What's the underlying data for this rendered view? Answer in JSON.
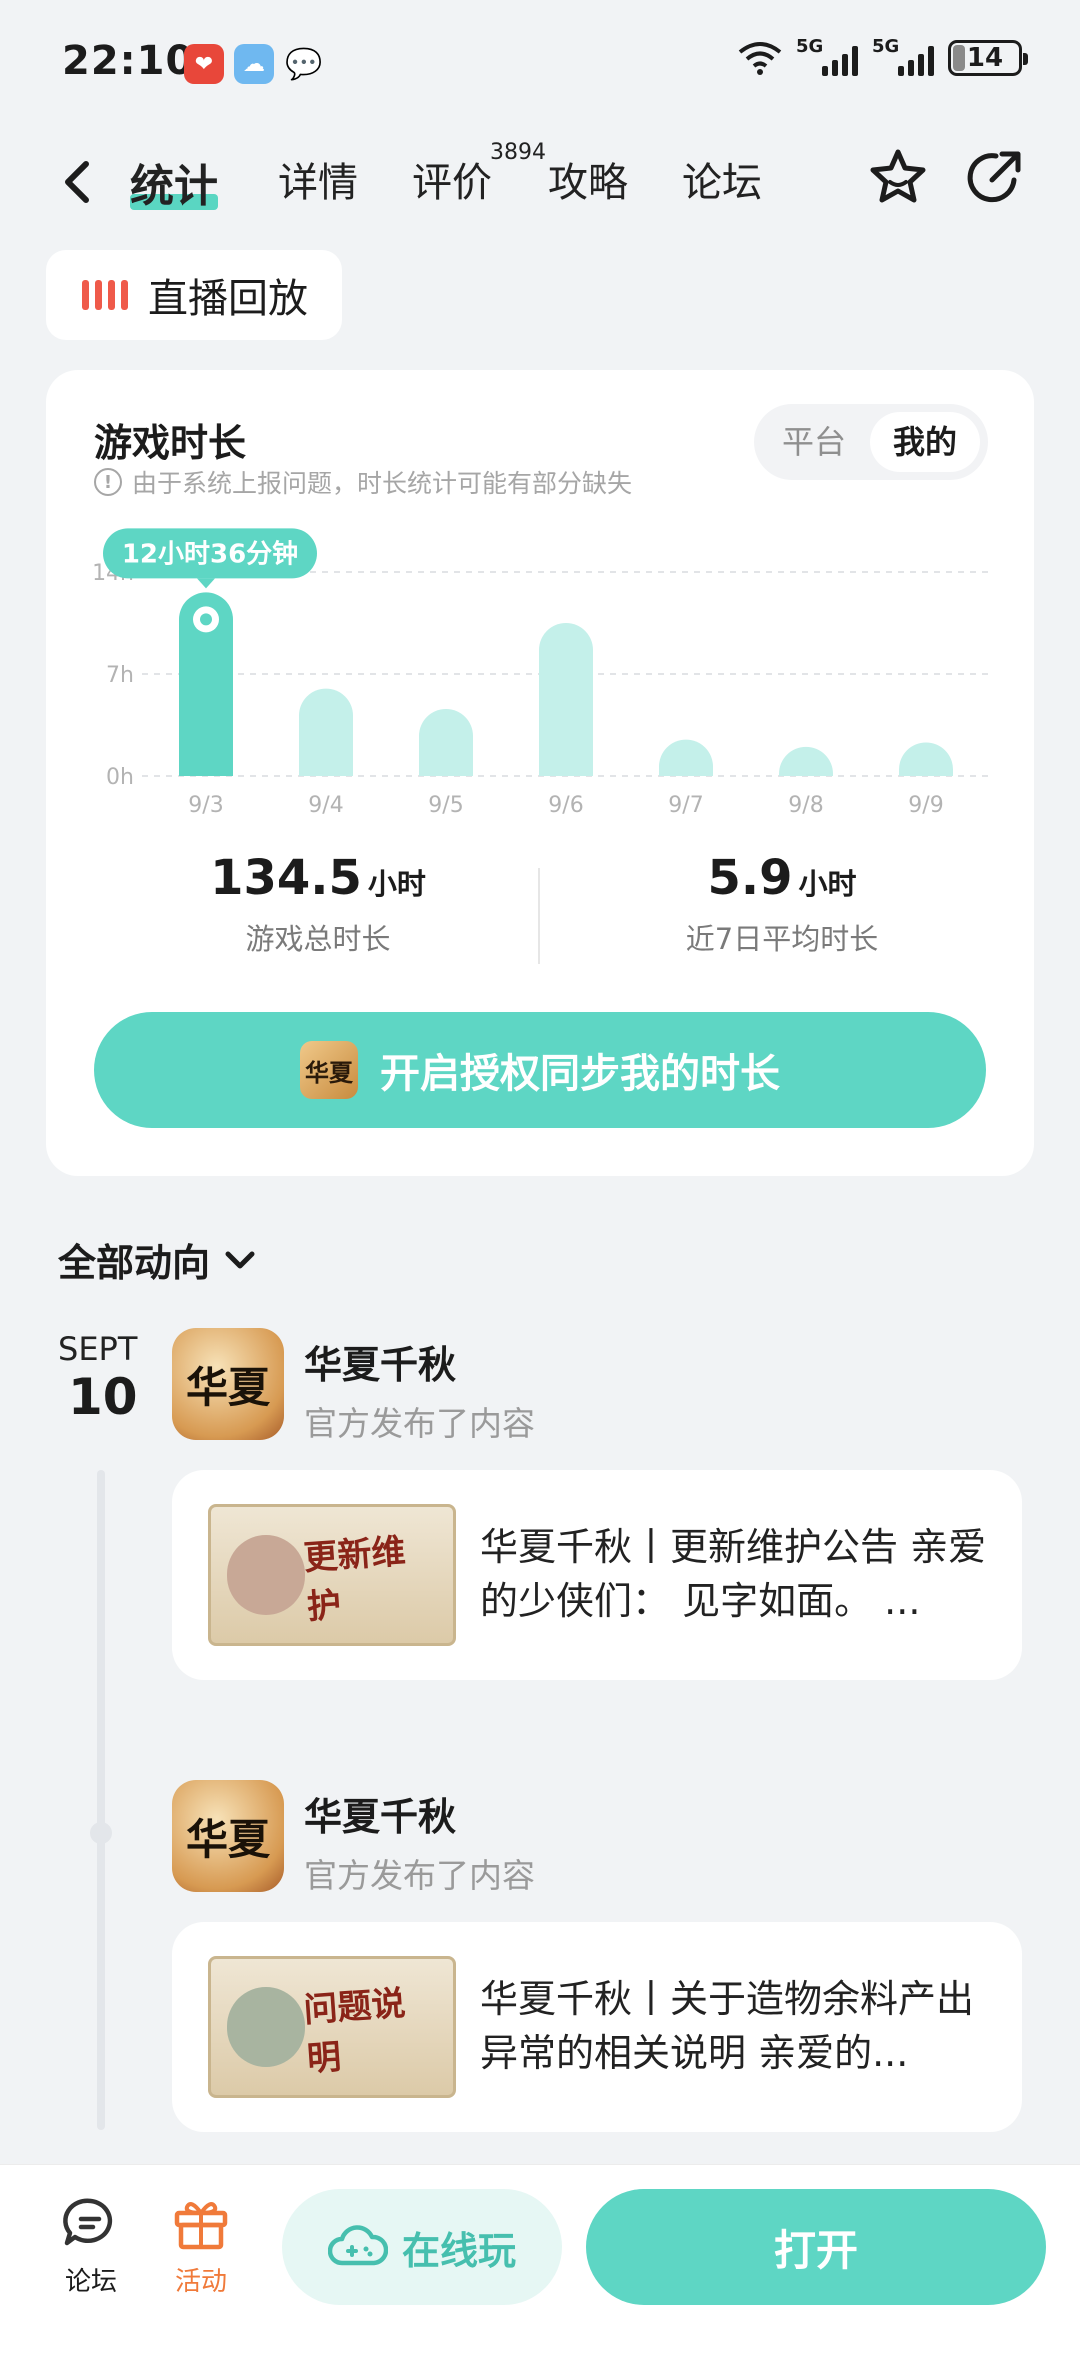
{
  "status": {
    "time": "22:10",
    "network_1": "5G",
    "network_2": "5G",
    "battery": "14"
  },
  "nav": {
    "tabs": [
      "统计",
      "详情",
      "评价",
      "攻略",
      "论坛"
    ],
    "active_tab": "统计",
    "review_count": "3894"
  },
  "live": {
    "label": "直播回放"
  },
  "stats": {
    "title": "游戏时长",
    "note": "由于系统上报问题，时长统计可能有部分缺失",
    "segments": {
      "platform": "平台",
      "mine": "我的",
      "selected": "我的"
    },
    "total_value": "134.5",
    "total_unit": "小时",
    "total_label": "游戏总时长",
    "avg_value": "5.9",
    "avg_unit": "小时",
    "avg_label": "近7日平均时长",
    "sync_button": "开启授权同步我的时长",
    "sync_icon_text": "华夏"
  },
  "chart_data": {
    "type": "bar",
    "categories": [
      "9/3",
      "9/4",
      "9/5",
      "9/6",
      "9/7",
      "9/8",
      "9/9"
    ],
    "values": [
      12.6,
      6.0,
      4.6,
      10.5,
      2.5,
      2.0,
      2.3
    ],
    "y_ticks": [
      "0h",
      "7h",
      "14h"
    ],
    "ylim": [
      0,
      14
    ],
    "highlight_index": 0,
    "tooltip": "12小时36分钟",
    "colors": {
      "highlight": "#5ed6c4",
      "normal": "#c4f0ea",
      "tooltip_bg": "#5ed6c4"
    }
  },
  "feed": {
    "filter_label": "全部动向",
    "date_month": "SEPT",
    "date_day": "10",
    "avatar_text": "华夏",
    "posts": [
      {
        "author": "华夏千秋",
        "action": "官方发布了内容",
        "thumb_text": "更新维护",
        "text": "华夏千秋丨更新维护公告 亲爱的少侠们： 见字如面。 ..."
      },
      {
        "author": "华夏千秋",
        "action": "官方发布了内容",
        "thumb_text": "问题说明",
        "text": "华夏千秋丨关于造物余料产出异常的相关说明 亲爱的..."
      }
    ]
  },
  "bottom": {
    "forum": "论坛",
    "activity": "活动",
    "online_play": "在线玩",
    "open": "打开",
    "activity_color": "#f07a3a"
  }
}
